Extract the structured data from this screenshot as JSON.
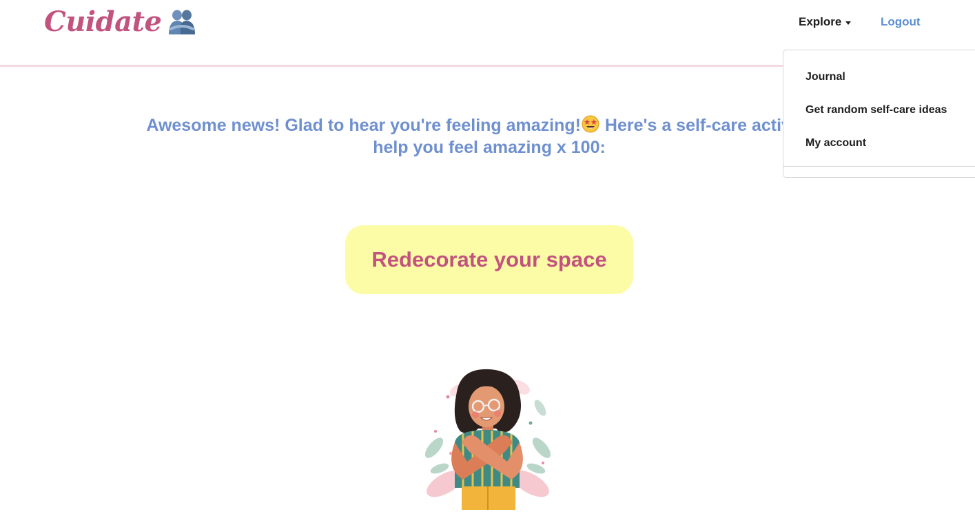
{
  "navbar": {
    "brand": "Cuidate",
    "brand_icon": "people-hugging-icon",
    "explore_label": "Explore",
    "logout_label": "Logout"
  },
  "dropdown": {
    "items": [
      {
        "label": "Journal"
      },
      {
        "label": "Get random self-care ideas"
      },
      {
        "label": "My account"
      }
    ]
  },
  "main": {
    "message_before_emoji": "Awesome news! Glad to hear you're feeling amazing!",
    "emoji": "star-struck-emoji-icon",
    "message_after_emoji": " Here's a self-care activity to help you feel amazing x 100:",
    "activity": "Redecorate your space",
    "illustration": "woman-hugging-self-illustration"
  },
  "colors": {
    "brand": "#c2537f",
    "message_text": "#6f90cf",
    "logout_link": "#5b8ed6",
    "card_background": "#fdfca6",
    "nav_border": "#f1d9e2"
  }
}
